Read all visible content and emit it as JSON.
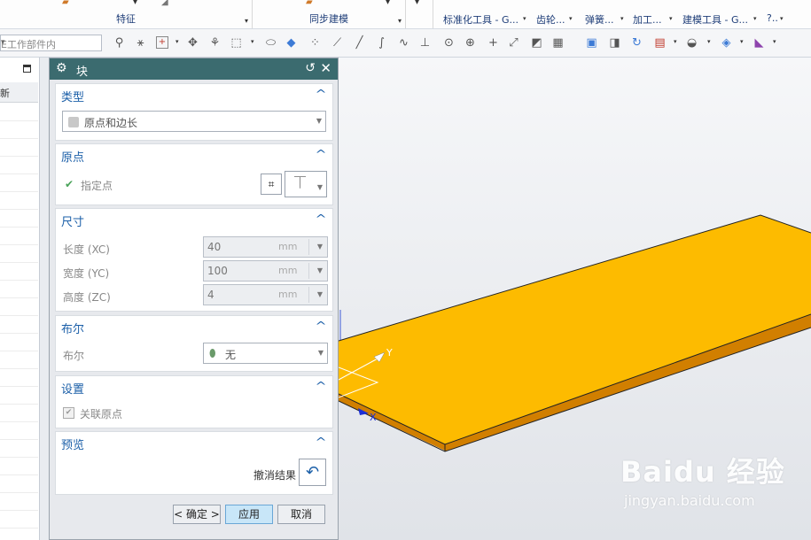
{
  "ribbon": {
    "groups": [
      {
        "label": "特征"
      },
      {
        "label": "同步建模"
      },
      {
        "label": ""
      }
    ],
    "tools": [
      "标准化工具 - G...",
      "齿轮...",
      "弹簧...",
      "加工...",
      "建模工具 - G...",
      "?.."
    ]
  },
  "toolbar": {
    "filter_text": "E工作部件内"
  },
  "navigator": {
    "header": "新"
  },
  "dialog": {
    "title": "块",
    "sections": {
      "type": {
        "title": "类型",
        "value": "原点和边长"
      },
      "origin": {
        "title": "原点",
        "specify_point": "指定点"
      },
      "dimensions": {
        "title": "尺寸",
        "rows": [
          {
            "label": "长度 (XC)",
            "value": "40",
            "unit": "mm"
          },
          {
            "label": "宽度 (YC)",
            "value": "100",
            "unit": "mm"
          },
          {
            "label": "高度 (ZC)",
            "value": "4",
            "unit": "mm"
          }
        ]
      },
      "boolean": {
        "title": "布尔",
        "label": "布尔",
        "value": "无"
      },
      "settings": {
        "title": "设置",
        "associative_origin": "关联原点"
      },
      "preview": {
        "title": "预览",
        "undo_result": "撤消结果"
      }
    },
    "buttons": {
      "ok": "< 确定 >",
      "apply": "应用",
      "cancel": "取消"
    }
  },
  "viewport": {
    "axis_x": "X",
    "axis_y": "Y",
    "block_top_color": "#FDBB00",
    "block_side_color": "#D17F00"
  },
  "watermark": {
    "brand": "Baidu 经验",
    "url": "jingyan.baidu.com"
  },
  "colors": {
    "accent": "#1b5fa8",
    "title_bar": "#3b6b6f",
    "apply_button": "#c8e6f8"
  }
}
